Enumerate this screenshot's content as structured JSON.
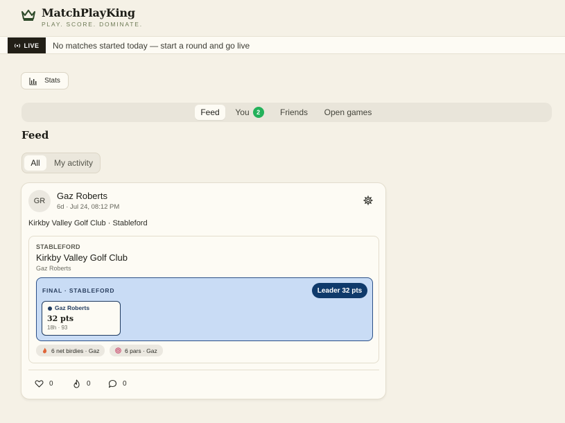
{
  "brand": {
    "name": "MatchPlayKing",
    "tagline": "PLAY. SCORE. DOMINATE."
  },
  "live": {
    "badge": "LIVE",
    "message": "No matches started today — start a round and go live"
  },
  "stats_button": {
    "label": "Stats"
  },
  "tabs": [
    {
      "label": "Feed",
      "active": true
    },
    {
      "label": "You",
      "badge": "2"
    },
    {
      "label": "Friends"
    },
    {
      "label": "Open games"
    }
  ],
  "feed": {
    "title": "Feed",
    "filters": [
      {
        "label": "All",
        "active": true
      },
      {
        "label": "My activity"
      }
    ]
  },
  "post": {
    "avatar_initials": "GR",
    "author": "Gaz Roberts",
    "time": "6d · Jul 24, 08:12 PM",
    "subtitle": "Kirkby Valley Golf Club · Stableford",
    "round": {
      "format_label": "STABLEFORD",
      "course": "Kirkby Valley Golf Club",
      "player": "Gaz Roberts",
      "final_label": "FINAL · STABLEFORD",
      "leader": "Leader 32 pts",
      "score": {
        "name": "Gaz Roberts",
        "points": "32 pts",
        "meta": "18h · 93"
      }
    },
    "highlights": [
      {
        "icon": "flame-icon",
        "label": "6 net birdies · Gaz"
      },
      {
        "icon": "target-icon",
        "label": "6 pars · Gaz"
      }
    ],
    "actions": {
      "likes": "0",
      "fires": "0",
      "comments": "0"
    }
  },
  "colors": {
    "accent_green": "#23b15a",
    "leader_blue": "#0f3a6b",
    "result_bg": "#c9dcf5"
  }
}
